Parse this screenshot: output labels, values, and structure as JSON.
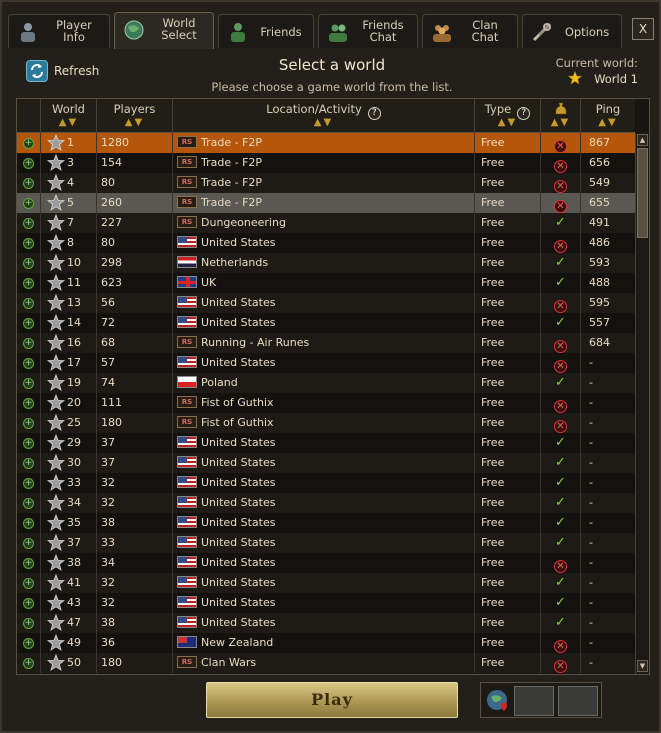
{
  "tabs": [
    {
      "label": "Player\nInfo",
      "icon": "player-info-icon",
      "active": false
    },
    {
      "label": "World\nSelect",
      "icon": "globe-icon",
      "active": true
    },
    {
      "label": "Friends",
      "icon": "friends-icon",
      "active": false
    },
    {
      "label": "Friends\nChat",
      "icon": "friends-chat-icon",
      "active": false
    },
    {
      "label": "Clan\nChat",
      "icon": "clan-chat-icon",
      "active": false
    },
    {
      "label": "Options",
      "icon": "tools-icon",
      "active": false
    }
  ],
  "close_label": "X",
  "header": {
    "refresh_label": "Refresh",
    "title": "Select a world",
    "subtitle": "Please choose a game world from the list.",
    "current_world_label": "Current world:",
    "current_world_value": "World 1"
  },
  "columns": {
    "world": "World",
    "players": "Players",
    "location": "Location/Activity",
    "type": "Type",
    "ping": "Ping",
    "help_glyph": "?"
  },
  "rows": [
    {
      "world": "1",
      "players": "1280",
      "flag": "rs",
      "location": "Trade - F2P",
      "type": "Free",
      "members": "x",
      "ping": "867",
      "state": "sel"
    },
    {
      "world": "3",
      "players": "154",
      "flag": "rs",
      "location": "Trade - F2P",
      "type": "Free",
      "members": "x",
      "ping": "656"
    },
    {
      "world": "4",
      "players": "80",
      "flag": "rs",
      "location": "Trade - F2P",
      "type": "Free",
      "members": "x",
      "ping": "549"
    },
    {
      "world": "5",
      "players": "260",
      "flag": "rs",
      "location": "Trade - F2P",
      "type": "Free",
      "members": "x",
      "ping": "655",
      "state": "hov"
    },
    {
      "world": "7",
      "players": "227",
      "flag": "rs",
      "location": "Dungeoneering",
      "type": "Free",
      "members": "ok",
      "ping": "491"
    },
    {
      "world": "8",
      "players": "80",
      "flag": "us",
      "location": "United States",
      "type": "Free",
      "members": "x",
      "ping": "486"
    },
    {
      "world": "10",
      "players": "298",
      "flag": "nl",
      "location": "Netherlands",
      "type": "Free",
      "members": "ok",
      "ping": "593"
    },
    {
      "world": "11",
      "players": "623",
      "flag": "uk",
      "location": "UK",
      "type": "Free",
      "members": "ok",
      "ping": "488"
    },
    {
      "world": "13",
      "players": "56",
      "flag": "us",
      "location": "United States",
      "type": "Free",
      "members": "x",
      "ping": "595"
    },
    {
      "world": "14",
      "players": "72",
      "flag": "us",
      "location": "United States",
      "type": "Free",
      "members": "ok",
      "ping": "557"
    },
    {
      "world": "16",
      "players": "68",
      "flag": "rs",
      "location": "Running - Air Runes",
      "type": "Free",
      "members": "x",
      "ping": "684"
    },
    {
      "world": "17",
      "players": "57",
      "flag": "us",
      "location": "United States",
      "type": "Free",
      "members": "x",
      "ping": "-"
    },
    {
      "world": "19",
      "players": "74",
      "flag": "pl",
      "location": "Poland",
      "type": "Free",
      "members": "ok",
      "ping": "-"
    },
    {
      "world": "20",
      "players": "111",
      "flag": "rs",
      "location": "Fist of Guthix",
      "type": "Free",
      "members": "x",
      "ping": "-"
    },
    {
      "world": "25",
      "players": "180",
      "flag": "rs",
      "location": "Fist of Guthix",
      "type": "Free",
      "members": "x",
      "ping": "-"
    },
    {
      "world": "29",
      "players": "37",
      "flag": "us",
      "location": "United States",
      "type": "Free",
      "members": "ok",
      "ping": "-"
    },
    {
      "world": "30",
      "players": "37",
      "flag": "us",
      "location": "United States",
      "type": "Free",
      "members": "ok",
      "ping": "-"
    },
    {
      "world": "33",
      "players": "32",
      "flag": "us",
      "location": "United States",
      "type": "Free",
      "members": "ok",
      "ping": "-"
    },
    {
      "world": "34",
      "players": "32",
      "flag": "us",
      "location": "United States",
      "type": "Free",
      "members": "ok",
      "ping": "-"
    },
    {
      "world": "35",
      "players": "38",
      "flag": "us",
      "location": "United States",
      "type": "Free",
      "members": "ok",
      "ping": "-"
    },
    {
      "world": "37",
      "players": "33",
      "flag": "us",
      "location": "United States",
      "type": "Free",
      "members": "ok",
      "ping": "-"
    },
    {
      "world": "38",
      "players": "34",
      "flag": "us",
      "location": "United States",
      "type": "Free",
      "members": "x",
      "ping": "-"
    },
    {
      "world": "41",
      "players": "32",
      "flag": "us",
      "location": "United States",
      "type": "Free",
      "members": "ok",
      "ping": "-"
    },
    {
      "world": "43",
      "players": "32",
      "flag": "us",
      "location": "United States",
      "type": "Free",
      "members": "ok",
      "ping": "-"
    },
    {
      "world": "47",
      "players": "38",
      "flag": "us",
      "location": "United States",
      "type": "Free",
      "members": "ok",
      "ping": "-"
    },
    {
      "world": "49",
      "players": "36",
      "flag": "nz",
      "location": "New Zealand",
      "type": "Free",
      "members": "x",
      "ping": "-"
    },
    {
      "world": "50",
      "players": "180",
      "flag": "rs",
      "location": "Clan Wars",
      "type": "Free",
      "members": "x",
      "ping": "-"
    }
  ],
  "flag_rs_text": "RS",
  "play_label": "Play",
  "colors": {
    "selected_row": "#b4560c",
    "hover_row": "#5a5852",
    "accent_gold": "#c79b2b"
  }
}
